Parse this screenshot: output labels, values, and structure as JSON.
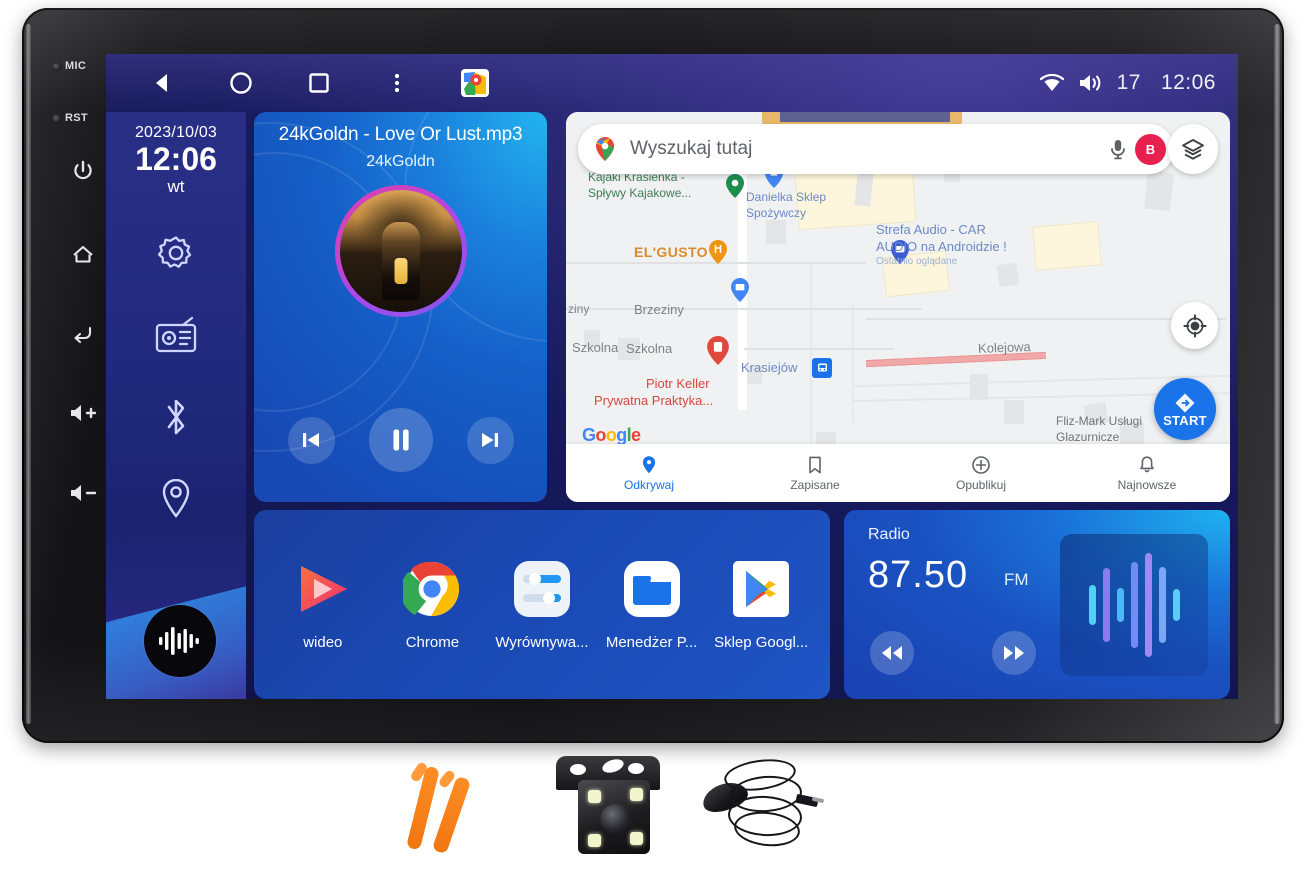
{
  "hardware": {
    "buttons": [
      {
        "name": "mic-indicator",
        "label": "MIC"
      },
      {
        "name": "reset-indicator",
        "label": "RST"
      },
      {
        "name": "power-button",
        "label": "power-icon"
      },
      {
        "name": "home-button",
        "label": "home-icon"
      },
      {
        "name": "back-button",
        "label": "back-arrow-icon"
      },
      {
        "name": "volume-up-button",
        "label": "volume-up-icon"
      },
      {
        "name": "volume-down-button",
        "label": "volume-down-icon"
      }
    ]
  },
  "status_bar": {
    "nav": [
      {
        "name": "android-back",
        "icon": "back-triangle-icon"
      },
      {
        "name": "android-home",
        "icon": "home-circle-icon"
      },
      {
        "name": "android-recents",
        "icon": "recents-square-icon"
      },
      {
        "name": "android-overflow",
        "icon": "three-dot-menu-icon"
      },
      {
        "name": "maps-shortcut",
        "icon": "google-maps-icon"
      }
    ],
    "wifi_icon": "wifi-icon",
    "volume_icon": "volume-icon",
    "volume_level": "17",
    "clock": "12:06"
  },
  "rail": {
    "date": "2023/10/03",
    "time": "12:06",
    "weekday": "wt",
    "icons": [
      {
        "name": "settings-icon",
        "label": "settings"
      },
      {
        "name": "radio-icon",
        "label": "radio"
      },
      {
        "name": "bluetooth-icon",
        "label": "bluetooth"
      },
      {
        "name": "location-icon",
        "label": "navigation"
      }
    ],
    "music_button_icon": "equalizer-icon"
  },
  "music": {
    "title": "24kGoldn - Love Or Lust.mp3",
    "artist": "24kGoldn",
    "prev_icon": "skip-previous-icon",
    "play_icon": "pause-icon",
    "next_icon": "skip-next-icon",
    "state": "playing"
  },
  "map": {
    "search_placeholder": "Wyszukaj tutaj",
    "mic_icon": "microphone-icon",
    "avatar_initial": "B",
    "layers_icon": "map-layers-icon",
    "mylocation_icon": "my-location-icon",
    "start_label": "START",
    "start_icon": "navigation-arrow-icon",
    "google_logo": [
      "G",
      "o",
      "o",
      "g",
      "l",
      "e"
    ],
    "pois": [
      {
        "name": "poi-kajaki",
        "text": "Kajaki Krasieńka -",
        "text2": "Spływy Kajakowe...",
        "color": "green"
      },
      {
        "name": "poi-danielka",
        "text": "Danielka Sklep",
        "text2": "Spożywczy",
        "color": "blue"
      },
      {
        "name": "poi-elgusto",
        "text": "EL'GUSTO",
        "color": "orange"
      },
      {
        "name": "poi-strefa-audio",
        "text": "Strefa Audio - CAR",
        "text2": "AUDIO na Androidzie !",
        "sub": "Ostatnio oglądane",
        "color": "blue"
      },
      {
        "name": "poi-piotr-keller",
        "text": "Piotr Keller",
        "text2": "Prywatna Praktyka...",
        "color": "red"
      },
      {
        "name": "poi-fliz-mark",
        "text": "Fliz-Mark Usługi",
        "text2": "Glazurnicze",
        "color": "gray"
      },
      {
        "name": "poi-krasiejow",
        "text": "Krasiejów",
        "color": "blue"
      }
    ],
    "streets": [
      {
        "name": "street-brzeziny",
        "text": "Brzeziny"
      },
      {
        "name": "street-ziny",
        "text": "ziny"
      },
      {
        "name": "street-szkolna-1",
        "text": "Szkolna"
      },
      {
        "name": "street-szkolna-2",
        "text": "Szkolna"
      },
      {
        "name": "street-kolejowa",
        "text": "Kolejowa"
      }
    ],
    "bottom_nav": [
      {
        "name": "map-tab-odkrywaj",
        "label": "Odkrywaj",
        "icon": "location-pin-icon",
        "active": true
      },
      {
        "name": "map-tab-zapisane",
        "label": "Zapisane",
        "icon": "bookmark-icon",
        "active": false
      },
      {
        "name": "map-tab-opublikuj",
        "label": "Opublikuj",
        "icon": "plus-circle-icon",
        "active": false
      },
      {
        "name": "map-tab-najnowsze",
        "label": "Najnowsze",
        "icon": "bell-icon",
        "active": false
      }
    ]
  },
  "apps": [
    {
      "name": "app-wideo",
      "label": "wideo",
      "icon": "video-player-icon"
    },
    {
      "name": "app-chrome",
      "label": "Chrome",
      "icon": "chrome-icon"
    },
    {
      "name": "app-wyrownywanie",
      "label": "Wyrównywa...",
      "icon": "equalizer-settings-icon"
    },
    {
      "name": "app-menedzer-plikow",
      "label": "Menedżer P...",
      "icon": "file-manager-icon"
    },
    {
      "name": "app-sklep-google",
      "label": "Sklep Googl...",
      "icon": "play-store-icon"
    }
  ],
  "radio": {
    "title": "Radio",
    "frequency": "87.50",
    "band": "FM",
    "prev_icon": "rewind-icon",
    "next_icon": "fast-forward-icon",
    "viz_icon": "audio-waveform-icon"
  },
  "accessories": [
    {
      "name": "pry-tools",
      "label": "trim removal tools"
    },
    {
      "name": "backup-camera",
      "label": "rear view camera"
    },
    {
      "name": "external-microphone",
      "label": "external microphone"
    }
  ],
  "colors": {
    "accent_blue": "#1a73e8",
    "card_blue": "#1a52c2",
    "rail_blue": "#222a7e",
    "avatar_pink": "#e8204f"
  }
}
